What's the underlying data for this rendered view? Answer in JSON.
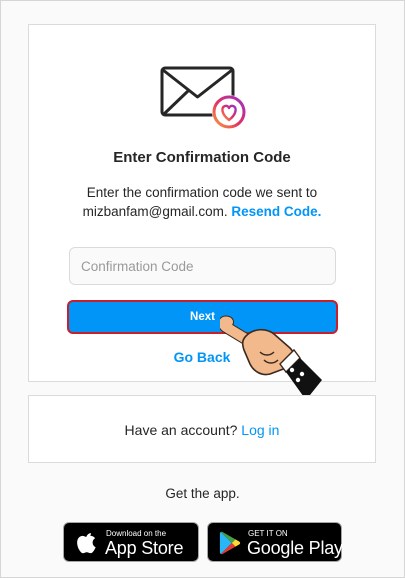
{
  "confirm": {
    "title": "Enter Confirmation Code",
    "description": "Enter the confirmation code we sent to mizbanfam@gmail.com.",
    "resend_label": "Resend Code.",
    "code_placeholder": "Confirmation Code",
    "code_value": "",
    "next_label": "Next",
    "goback_label": "Go Back",
    "icons": [
      "envelope-heart-icon",
      "pointing-hand-icon"
    ]
  },
  "account": {
    "prompt": "Have an account?",
    "login_label": "Log in"
  },
  "apps": {
    "get_app": "Get the app.",
    "appstore_small": "Download on the",
    "appstore_big": "App Store",
    "googleplay_small": "GET IT ON",
    "googleplay_big": "Google Play"
  },
  "colors": {
    "accent": "#0095f6",
    "highlight_border": "#c8202b",
    "text": "#262626",
    "background": "#fafafa"
  }
}
